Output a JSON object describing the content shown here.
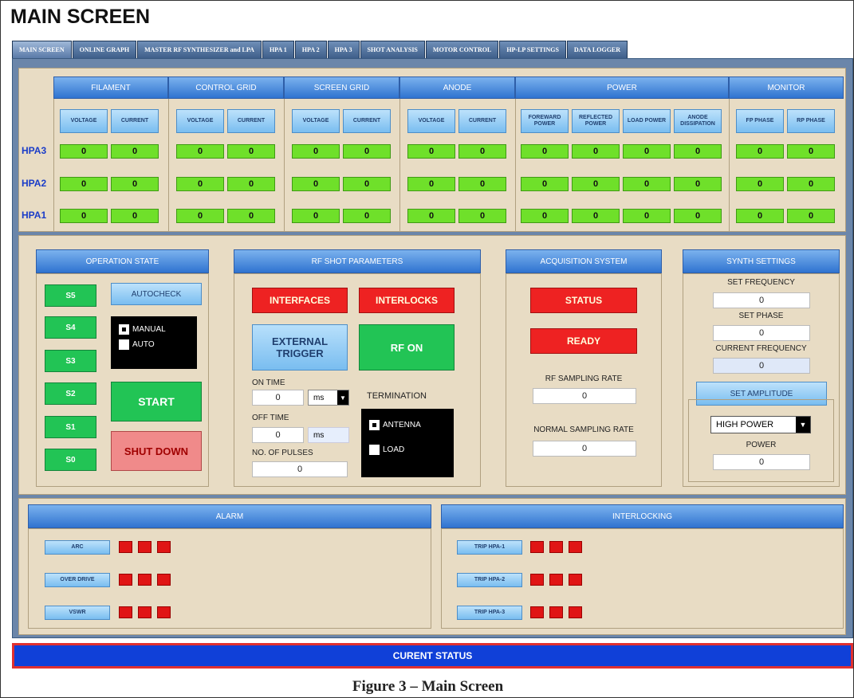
{
  "window": {
    "title": "MAIN SCREEN"
  },
  "tabs": [
    "MAIN SCREEN",
    "ONLINE GRAPH",
    "MASTER RF SYNTHESIZER and LPA",
    "HPA 1",
    "HPA 2",
    "HPA 3",
    "SHOT ANALYSIS",
    "MOTOR CONTROL",
    "HP-LP SETTINGS",
    "DATA LOGGER"
  ],
  "grid": {
    "groups": [
      "FILAMENT",
      "CONTROL GRID",
      "SCREEN GRID",
      "ANODE",
      "POWER",
      "MONITOR"
    ],
    "vc": {
      "voltage": "VOLTAGE",
      "current": "CURRENT"
    },
    "power_cols": [
      "FOREWARD POWER",
      "REFLECTED POWER",
      "LOAD POWER",
      "ANODE DISSIPATION"
    ],
    "monitor_cols": [
      "FP PHASE",
      "RP PHASE"
    ],
    "rows": [
      "HPA3",
      "HPA2",
      "HPA1"
    ],
    "value": "0"
  },
  "operation_state": {
    "title": "OPERATION STATE",
    "stages": [
      "S5",
      "S4",
      "S3",
      "S2",
      "S1",
      "S0"
    ],
    "autocheck": "AUTOCHECK",
    "manual": "MANUAL",
    "auto": "AUTO",
    "start": "START",
    "shutdown": "SHUT DOWN"
  },
  "rf_shot": {
    "title": "RF SHOT PARAMETERS",
    "interfaces": "INTERFACES",
    "interlocks": "INTERLOCKS",
    "external_trigger": "EXTERNAL TRIGGER",
    "rf_on": "RF ON",
    "on_time_label": "ON TIME",
    "on_time_value": "0",
    "on_time_unit": "ms",
    "off_time_label": "OFF TIME",
    "off_time_value": "0",
    "off_time_unit": "ms",
    "pulses_label": "NO. OF PULSES",
    "pulses_value": "0",
    "termination_label": "TERMINATION",
    "antenna": "ANTENNA",
    "load": "LOAD"
  },
  "acquisition": {
    "title": "ACQUISITION SYSTEM",
    "status": "STATUS",
    "ready": "READY",
    "rf_rate_label": "RF SAMPLING RATE",
    "rf_rate_value": "0",
    "normal_rate_label": "NORMAL SAMPLING RATE",
    "normal_rate_value": "0"
  },
  "synth": {
    "title": "SYNTH SETTINGS",
    "set_freq_label": "SET FREQUENCY",
    "set_freq_value": "0",
    "set_phase_label": "SET PHASE",
    "set_phase_value": "0",
    "cur_freq_label": "CURRENT FREQUENCY",
    "cur_freq_value": "0",
    "set_amp": "SET AMPLITUDE",
    "power_mode": "HIGH POWER",
    "power_label": "POWER",
    "power_value": "0"
  },
  "alarm": {
    "title": "ALARM",
    "items": [
      "ARC",
      "OVER DRIVE",
      "VSWR"
    ]
  },
  "interlocking": {
    "title": "INTERLOCKING",
    "items": [
      "TRIP HPA-1",
      "TRIP HPA-2",
      "TRIP HPA-3"
    ]
  },
  "status_bar": {
    "label": "CURENT STATUS"
  },
  "caption": "Figure 3 – Main Screen",
  "colors": {
    "accent_blue": "#2f73d0",
    "indicator_green": "#6fe02a",
    "alarm_red": "#e01515",
    "panel_bg": "#e8dcc4",
    "status_bar": "#1040d8"
  }
}
